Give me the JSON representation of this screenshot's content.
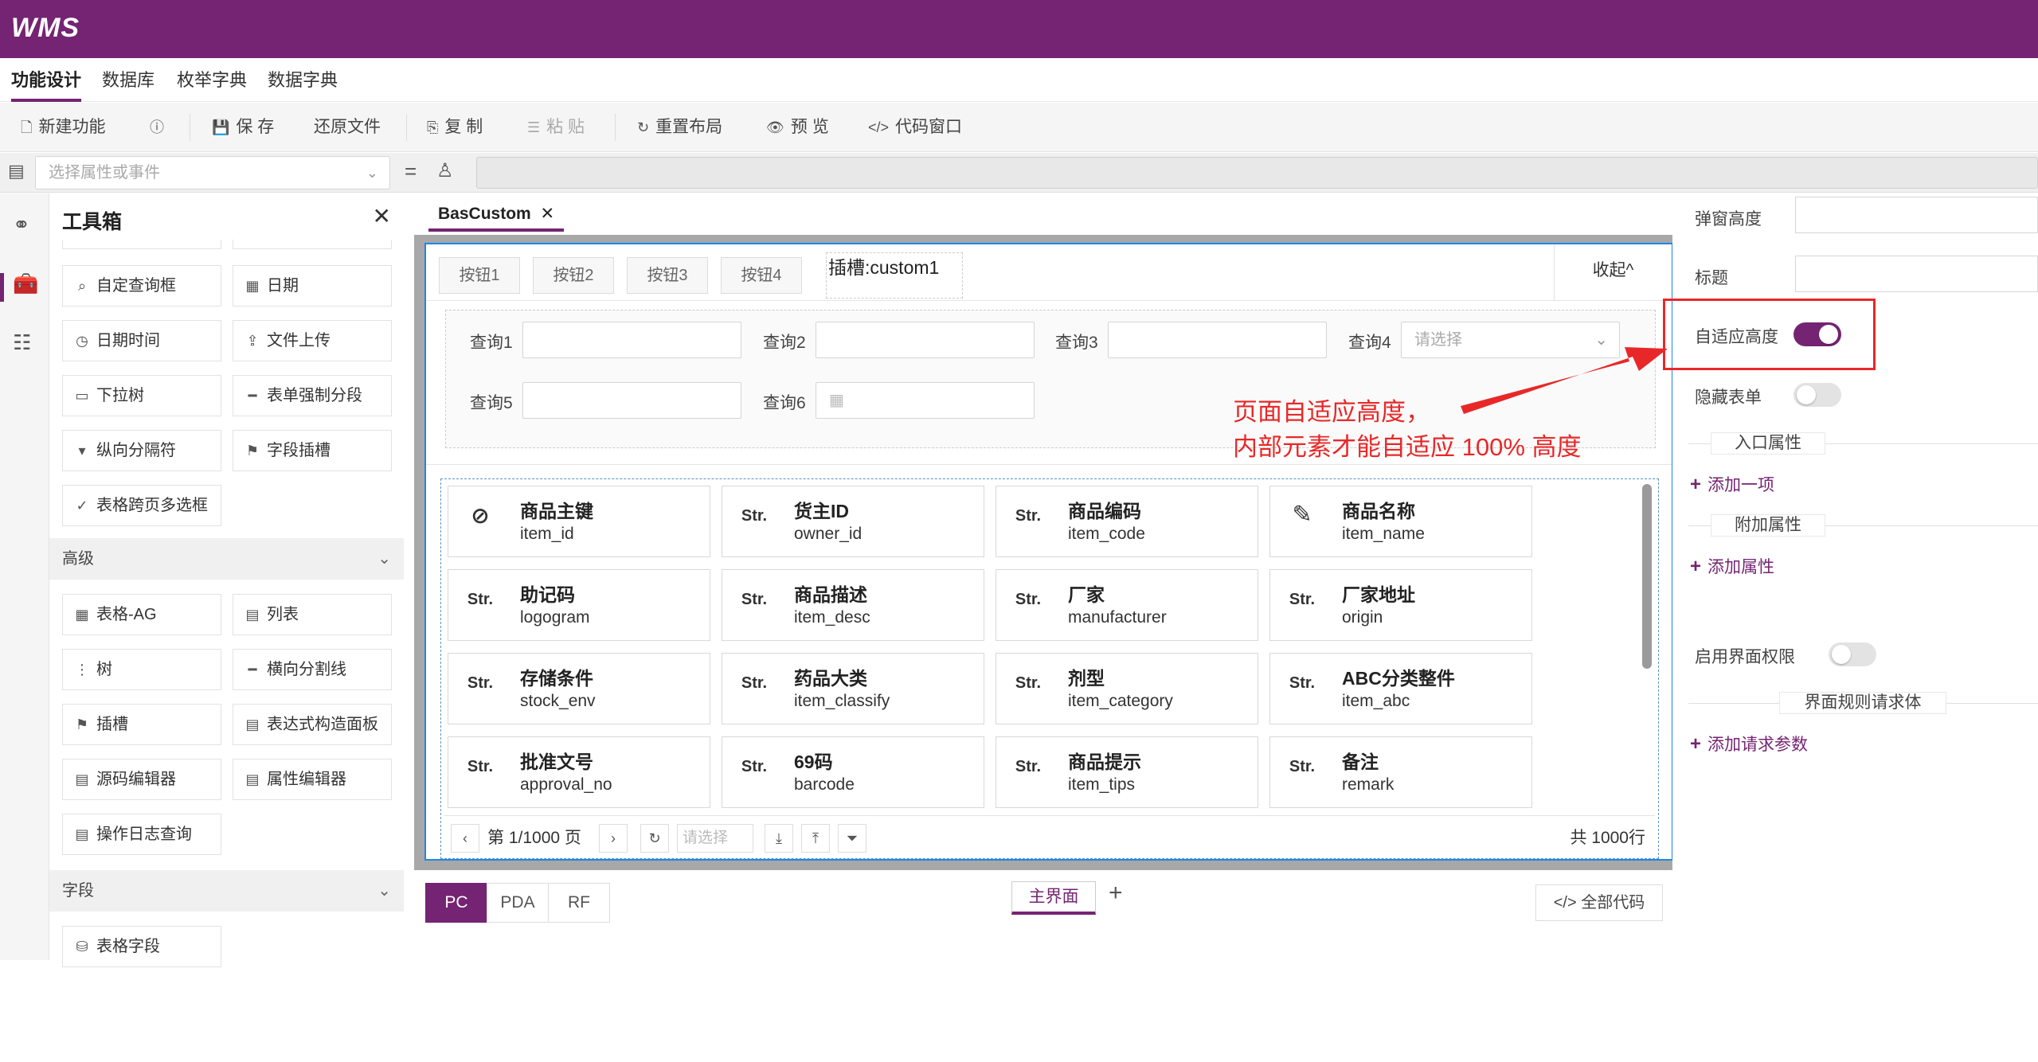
{
  "app": {
    "logo": "WMS"
  },
  "menu": [
    "功能设计",
    "数据库",
    "枚举字典",
    "数据字典"
  ],
  "toolbar": {
    "new": "新建功能",
    "save": "保 存",
    "restore": "还原文件",
    "copy": "复 制",
    "paste": "粘 贴",
    "reset_layout": "重置布局",
    "preview": "预 览",
    "code_window": "代码窗口"
  },
  "propbar": {
    "select_placeholder": "选择属性或事件"
  },
  "toolbox": {
    "title": "工具箱",
    "basic_items": [
      "自定查询框",
      "日期",
      "日期时间",
      "文件上传",
      "下拉树",
      "表单强制分段",
      "纵向分隔符",
      "字段插槽",
      "表格跨页多选框"
    ],
    "sections": {
      "advanced": "高级",
      "fields": "字段"
    },
    "advanced_items": [
      "表格-AG",
      "列表",
      "树",
      "横向分割线",
      "插槽",
      "表达式构造面板",
      "源码编辑器",
      "属性编辑器",
      "操作日志查询"
    ],
    "field_items": [
      "表格字段"
    ]
  },
  "editor": {
    "tab": "BasCustom",
    "slot_buttons": [
      "按钮1",
      "按钮2",
      "按钮3",
      "按钮4"
    ],
    "slot_label": "插槽:custom1",
    "collapse": "收起^",
    "queries": [
      {
        "label": "查询1",
        "placeholder": ""
      },
      {
        "label": "查询2",
        "placeholder": ""
      },
      {
        "label": "查询3",
        "placeholder": ""
      },
      {
        "label": "查询4",
        "placeholder": "请选择"
      },
      {
        "label": "查询5",
        "placeholder": ""
      },
      {
        "label": "查询6",
        "placeholder": ""
      }
    ],
    "cards": [
      {
        "icon": "eye-off-icon",
        "icon_text": "",
        "title": "商品主键",
        "sub": "item_id"
      },
      {
        "icon": "str-icon",
        "icon_text": "Str.",
        "title": "货主ID",
        "sub": "owner_id"
      },
      {
        "icon": "str-icon",
        "icon_text": "Str.",
        "title": "商品编码",
        "sub": "item_code"
      },
      {
        "icon": "pen-icon",
        "icon_text": "",
        "title": "商品名称",
        "sub": "item_name"
      },
      {
        "icon": "str-icon",
        "icon_text": "Str.",
        "title": "助记码",
        "sub": "logogram"
      },
      {
        "icon": "str-icon",
        "icon_text": "Str.",
        "title": "商品描述",
        "sub": "item_desc"
      },
      {
        "icon": "str-icon",
        "icon_text": "Str.",
        "title": "厂家",
        "sub": "manufacturer"
      },
      {
        "icon": "str-icon",
        "icon_text": "Str.",
        "title": "厂家地址",
        "sub": "origin"
      },
      {
        "icon": "str-icon",
        "icon_text": "Str.",
        "title": "存储条件",
        "sub": "stock_env"
      },
      {
        "icon": "str-icon",
        "icon_text": "Str.",
        "title": "药品大类",
        "sub": "item_classify"
      },
      {
        "icon": "str-icon",
        "icon_text": "Str.",
        "title": "剂型",
        "sub": "item_category"
      },
      {
        "icon": "str-icon",
        "icon_text": "Str.",
        "title": "ABC分类整件",
        "sub": "item_abc"
      },
      {
        "icon": "str-icon",
        "icon_text": "Str.",
        "title": "批准文号",
        "sub": "approval_no"
      },
      {
        "icon": "str-icon",
        "icon_text": "Str.",
        "title": "69码",
        "sub": "barcode"
      },
      {
        "icon": "str-icon",
        "icon_text": "Str.",
        "title": "商品提示",
        "sub": "item_tips"
      },
      {
        "icon": "str-icon",
        "icon_text": "Str.",
        "title": "备注",
        "sub": "remark"
      }
    ],
    "pager": {
      "page": "第 1/1000 页",
      "page_size_placeholder": "请选择",
      "total": "共 1000行"
    },
    "bottom_tabs": [
      "PC",
      "PDA",
      "RF"
    ],
    "main_tab": "主界面",
    "all_code": "全部代码"
  },
  "right": {
    "popup_height": "弹窗高度",
    "title": "标题",
    "auto_height": "自适应高度",
    "hide_form": "隐藏表单",
    "entry_props": "入口属性",
    "add_item": "添加一项",
    "extra_props": "附加属性",
    "add_prop": "添加属性",
    "enable_perm": "启用界面权限",
    "rule_body": "界面规则请求体",
    "add_param": "添加请求参数"
  },
  "annotation": {
    "line1": "页面自适应高度，",
    "line2": "内部元素才能自适应 100% 高度"
  },
  "colors": {
    "brand": "#742472",
    "highlight": "#e82828",
    "focus": "#1e88e5"
  }
}
